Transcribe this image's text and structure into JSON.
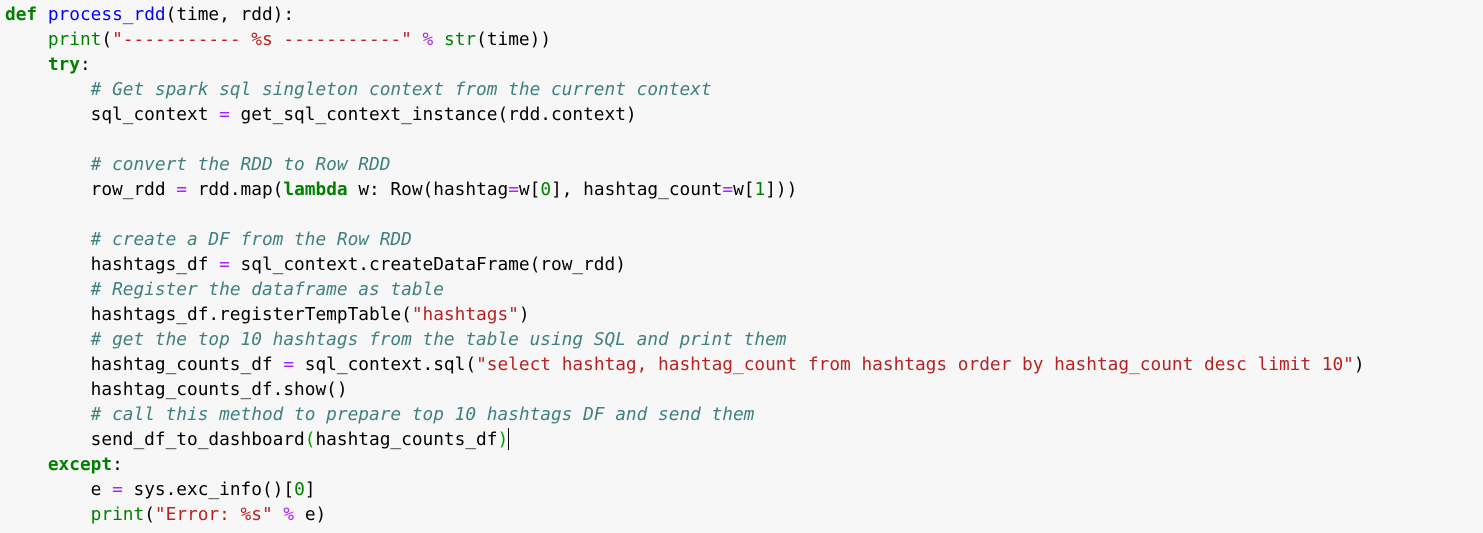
{
  "editor": {
    "lines": [
      [
        {
          "t": "def",
          "c": "keyword"
        },
        {
          "t": " ",
          "c": ""
        },
        {
          "t": "process_rdd",
          "c": "def"
        },
        {
          "t": "(time, rdd):",
          "c": ""
        }
      ],
      [
        {
          "t": "    ",
          "c": ""
        },
        {
          "t": "print",
          "c": "builtin"
        },
        {
          "t": "(",
          "c": ""
        },
        {
          "t": "\"----------- %s -----------\"",
          "c": "string"
        },
        {
          "t": " ",
          "c": ""
        },
        {
          "t": "%",
          "c": "operator"
        },
        {
          "t": " ",
          "c": ""
        },
        {
          "t": "str",
          "c": "builtin"
        },
        {
          "t": "(time))",
          "c": ""
        }
      ],
      [
        {
          "t": "    ",
          "c": ""
        },
        {
          "t": "try",
          "c": "keyword"
        },
        {
          "t": ":",
          "c": ""
        }
      ],
      [
        {
          "t": "        ",
          "c": ""
        },
        {
          "t": "# Get spark sql singleton context from the current context",
          "c": "comment"
        }
      ],
      [
        {
          "t": "        sql_context ",
          "c": ""
        },
        {
          "t": "=",
          "c": "operator"
        },
        {
          "t": " get_sql_context_instance(rdd.context)",
          "c": ""
        }
      ],
      [
        {
          "t": "",
          "c": ""
        }
      ],
      [
        {
          "t": "        ",
          "c": ""
        },
        {
          "t": "# convert the RDD to Row RDD",
          "c": "comment"
        }
      ],
      [
        {
          "t": "        row_rdd ",
          "c": ""
        },
        {
          "t": "=",
          "c": "operator"
        },
        {
          "t": " rdd.map(",
          "c": ""
        },
        {
          "t": "lambda",
          "c": "keyword"
        },
        {
          "t": " w: Row(hashtag",
          "c": ""
        },
        {
          "t": "=",
          "c": "operator"
        },
        {
          "t": "w[",
          "c": ""
        },
        {
          "t": "0",
          "c": "number"
        },
        {
          "t": "], hashtag_count",
          "c": ""
        },
        {
          "t": "=",
          "c": "operator"
        },
        {
          "t": "w[",
          "c": ""
        },
        {
          "t": "1",
          "c": "number"
        },
        {
          "t": "]))",
          "c": ""
        }
      ],
      [
        {
          "t": "",
          "c": ""
        }
      ],
      [
        {
          "t": "        ",
          "c": ""
        },
        {
          "t": "# create a DF from the Row RDD",
          "c": "comment"
        }
      ],
      [
        {
          "t": "        hashtags_df ",
          "c": ""
        },
        {
          "t": "=",
          "c": "operator"
        },
        {
          "t": " sql_context.createDataFrame(row_rdd)",
          "c": ""
        }
      ],
      [
        {
          "t": "        ",
          "c": ""
        },
        {
          "t": "# Register the dataframe as table",
          "c": "comment"
        }
      ],
      [
        {
          "t": "        hashtags_df.registerTempTable(",
          "c": ""
        },
        {
          "t": "\"hashtags\"",
          "c": "string"
        },
        {
          "t": ")",
          "c": ""
        }
      ],
      [
        {
          "t": "        ",
          "c": ""
        },
        {
          "t": "# get the top 10 hashtags from the table using SQL and print them",
          "c": "comment"
        }
      ],
      [
        {
          "t": "        hashtag_counts_df ",
          "c": ""
        },
        {
          "t": "=",
          "c": "operator"
        },
        {
          "t": " sql_context.sql(",
          "c": ""
        },
        {
          "t": "\"select hashtag, hashtag_count from hashtags order by hashtag_count desc limit 10\"",
          "c": "string"
        },
        {
          "t": ")",
          "c": ""
        }
      ],
      [
        {
          "t": "        hashtag_counts_df.show()",
          "c": ""
        }
      ],
      [
        {
          "t": "        ",
          "c": ""
        },
        {
          "t": "# call this method to prepare top 10 hashtags DF and send them",
          "c": "comment"
        }
      ],
      [
        {
          "t": "        send_df_to_dashboard",
          "c": ""
        },
        {
          "t": "(",
          "c": "bracket-match"
        },
        {
          "t": "hashtag_counts_df",
          "c": ""
        },
        {
          "t": ")",
          "c": "bracket-match"
        },
        {
          "t": "",
          "c": "cursor"
        }
      ],
      [
        {
          "t": "    ",
          "c": ""
        },
        {
          "t": "except",
          "c": "keyword"
        },
        {
          "t": ":",
          "c": ""
        }
      ],
      [
        {
          "t": "        e ",
          "c": ""
        },
        {
          "t": "=",
          "c": "operator"
        },
        {
          "t": " sys.exc_info()[",
          "c": ""
        },
        {
          "t": "0",
          "c": "number"
        },
        {
          "t": "]",
          "c": ""
        }
      ],
      [
        {
          "t": "        ",
          "c": ""
        },
        {
          "t": "print",
          "c": "builtin"
        },
        {
          "t": "(",
          "c": ""
        },
        {
          "t": "\"Error: %s\"",
          "c": "string"
        },
        {
          "t": " ",
          "c": ""
        },
        {
          "t": "%",
          "c": "operator"
        },
        {
          "t": " e)",
          "c": ""
        }
      ]
    ]
  }
}
